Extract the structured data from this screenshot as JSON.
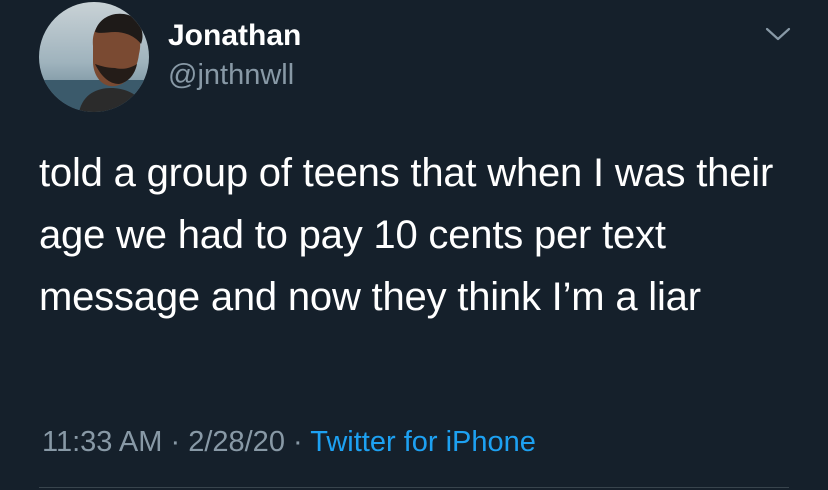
{
  "user": {
    "display_name": "Jonathan",
    "handle": "@jnthnwll"
  },
  "tweet": {
    "text": "told a group of teens that when I was their age we had to pay 10 cents per text message and now they think I’m a liar",
    "time": "11:33 AM",
    "date": "2/28/20",
    "separator": "·",
    "source": "Twitter for iPhone"
  },
  "icons": {
    "menu": "chevron-down-icon"
  },
  "colors": {
    "background": "#15202b",
    "secondary_text": "#8899a6",
    "link": "#1da1f2"
  }
}
